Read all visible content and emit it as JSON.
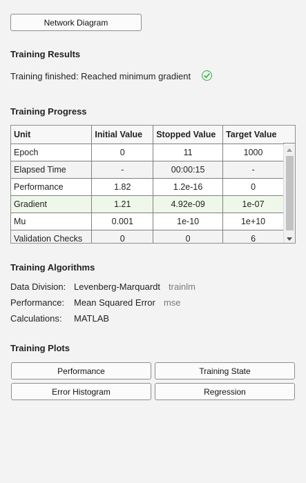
{
  "buttons": {
    "network_diagram": "Network Diagram"
  },
  "results": {
    "heading": "Training Results",
    "status_text": "Training finished: Reached minimum gradient",
    "status_icon": "check-circle-icon"
  },
  "progress": {
    "heading": "Training Progress",
    "columns": [
      "Unit",
      "Initial Value",
      "Stopped Value",
      "Target Value"
    ],
    "rows": [
      {
        "unit": "Epoch",
        "initial": "0",
        "stopped": "11",
        "target": "1000"
      },
      {
        "unit": "Elapsed Time",
        "initial": "-",
        "stopped": "00:00:15",
        "target": "-"
      },
      {
        "unit": "Performance",
        "initial": "1.82",
        "stopped": "1.2e-16",
        "target": "0"
      },
      {
        "unit": "Gradient",
        "initial": "1.21",
        "stopped": "4.92e-09",
        "target": "1e-07"
      },
      {
        "unit": "Mu",
        "initial": "0.001",
        "stopped": "1e-10",
        "target": "1e+10"
      },
      {
        "unit": "Validation Checks",
        "initial": "0",
        "stopped": "0",
        "target": "6"
      }
    ]
  },
  "algorithms": {
    "heading": "Training Algorithms",
    "data_division_label": "Data Division:",
    "data_division_value": "Levenberg-Marquardt",
    "data_division_code": "trainlm",
    "performance_label": "Performance:",
    "performance_value": "Mean Squared Error",
    "performance_code": "mse",
    "calculations_label": "Calculations:",
    "calculations_value": "MATLAB"
  },
  "plots": {
    "heading": "Training Plots",
    "performance": "Performance",
    "training_state": "Training State",
    "error_histogram": "Error Histogram",
    "regression": "Regression"
  },
  "colors": {
    "success": "#3fa54a",
    "highlight_row": "#eef7e9"
  }
}
